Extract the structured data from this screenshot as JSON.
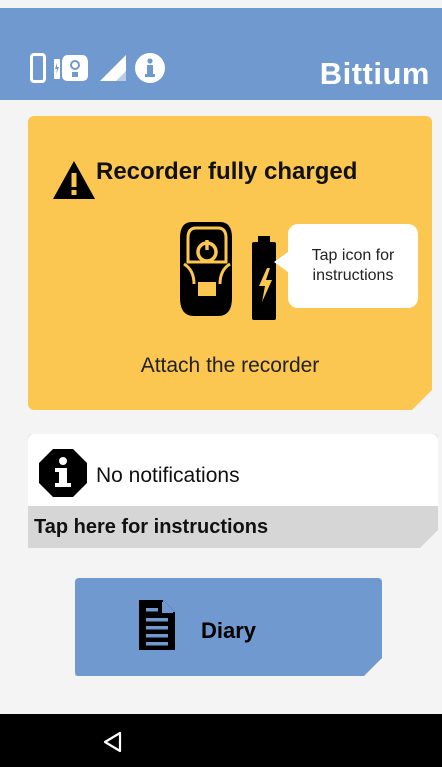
{
  "header": {
    "brand": "Bittium",
    "status_icons": [
      "phone-icon",
      "recorder-icon",
      "signal-icon",
      "info-icon"
    ],
    "color": "#6f99cf"
  },
  "status_card": {
    "title": "Recorder fully charged",
    "bubble_text": "Tap icon for instructions",
    "message": "Attach the recorder",
    "color": "#fbc751",
    "icons": [
      "warning-icon",
      "recorder-device-icon",
      "battery-charging-icon"
    ]
  },
  "notifications": {
    "text": "No notifications",
    "footer_label": "Tap here for instructions",
    "icon": "info-octagon-icon"
  },
  "diary": {
    "label": "Diary",
    "icon": "document-icon"
  },
  "navbar": {
    "icons": [
      "back-icon"
    ]
  }
}
